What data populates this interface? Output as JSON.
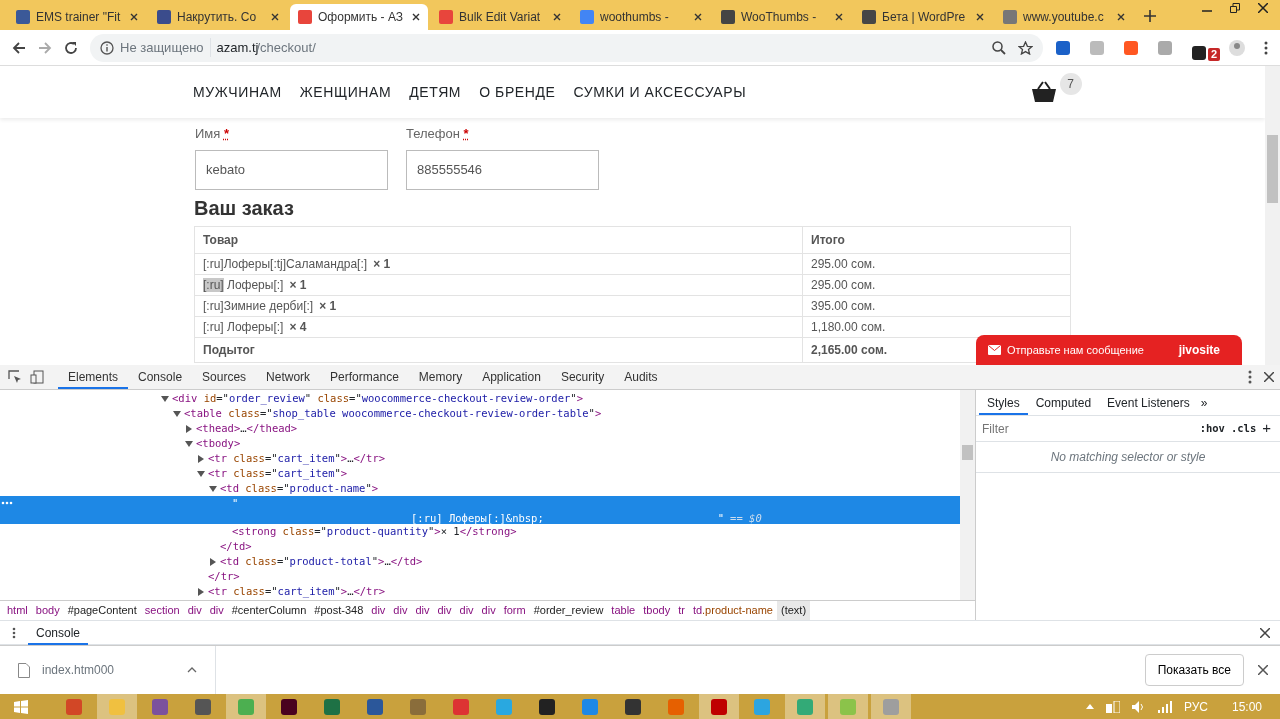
{
  "browser": {
    "tabs": [
      {
        "title": "EMS trainer \"Fit",
        "color": "#3b5998",
        "selected": false
      },
      {
        "title": "Накрутить. Co",
        "color": "#3b4c8c",
        "selected": false
      },
      {
        "title": "Оформить - АЗ",
        "color": "#e8453c",
        "selected": true
      },
      {
        "title": "Bulk Edit Variat",
        "color": "#e8453c",
        "selected": false
      },
      {
        "title": "woothumbs - ",
        "color": "#4285f4",
        "selected": false
      },
      {
        "title": "WooThumbs - ",
        "color": "#444444",
        "selected": false
      },
      {
        "title": "Бета | WordPre",
        "color": "#464646",
        "selected": false
      },
      {
        "title": "www.youtube.c",
        "color": "#777777",
        "selected": false
      }
    ],
    "security": "Не защищено",
    "url_host": "azam.tj",
    "url_path": "/checkout/",
    "extension_badge": "2"
  },
  "site": {
    "nav": [
      "МУЖЧИНАМ",
      "ЖЕНЩИНАМ",
      "ДЕТЯМ",
      "О БРЕНДЕ",
      "СУМКИ И АКСЕССУАРЫ"
    ],
    "cart_count": "7",
    "fields": [
      {
        "label": "Имя",
        "required_mark": "*",
        "value": "kebato"
      },
      {
        "label": "Телефон",
        "required_mark": "*",
        "value": "885555546"
      }
    ],
    "heading": "Ваш заказ",
    "table": {
      "columns": [
        "Товар",
        "Итого"
      ],
      "rows": [
        {
          "product": "[:ru]Лоферы[:tj]Саламандра[:]",
          "quantity": "× 1",
          "total": "295.00 сом."
        },
        {
          "highlighted_text": "[:ru]",
          "product": " Лоферы[:]",
          "quantity": "× 1",
          "total": "295.00 сом."
        },
        {
          "product": "[:ru]Зимние дерби[:]",
          "quantity": "× 1",
          "total": "395.00 сом."
        },
        {
          "product": "[:ru] Лоферы[:]",
          "quantity": "× 4",
          "total": "1,180.00 сом."
        }
      ],
      "subtotal_label": "Подытог",
      "subtotal": "2,165.00 сом."
    },
    "chat": {
      "text": "Отправьте нам сообщение",
      "brand": "jivosite"
    }
  },
  "devtools": {
    "tabs": [
      {
        "label": "Elements",
        "selected": true
      },
      {
        "label": "Console",
        "selected": false
      },
      {
        "label": "Sources",
        "selected": false
      },
      {
        "label": "Network",
        "selected": false
      },
      {
        "label": "Performance",
        "selected": false
      },
      {
        "label": "Memory",
        "selected": false
      },
      {
        "label": "Application",
        "selected": false
      },
      {
        "label": "Security",
        "selected": false
      },
      {
        "label": "Audits",
        "selected": false
      }
    ],
    "tree": [
      {
        "open": "<div id=\"order_review\" class=\"woocommerce-checkout-review-order\">",
        "expanded": true,
        "selected": false,
        "children": [
          {
            "open": "<table class=\"shop_table woocommerce-checkout-review-order-table\">",
            "expanded": true,
            "selected": false,
            "children": [
              {
                "open": "<thead>…</thead>",
                "expanded": false,
                "selected": false
              },
              {
                "open": "<tbody>",
                "expanded": true,
                "selected": false,
                "children": [
                  {
                    "open": "<tr class=\"cart_item\">…</tr>",
                    "expanded": false,
                    "selected": false
                  },
                  {
                    "open": "<tr class=\"cart_item\">",
                    "expanded": true,
                    "selected": false,
                    "children": [
                      {
                        "open": "<td class=\"product-name\">",
                        "expanded": true,
                        "selected": false,
                        "children": [
                          {
                            "text_lines": [
                              "\"",
                              "[:ru] Лоферы[:]&nbsp;"
                            ],
                            "suffix": "\"",
                            "ref": "== $0",
                            "selected": true
                          },
                          {
                            "open": "<strong class=\"product-quantity\">× 1</strong>",
                            "selected": false
                          }
                        ],
                        "close": "</td>"
                      },
                      {
                        "open": "<td class=\"product-total\">…</td>",
                        "expanded": false,
                        "selected": false
                      }
                    ],
                    "close": "</tr>"
                  },
                  {
                    "open": "<tr class=\"cart_item\">…</tr>",
                    "expanded": false,
                    "selected": false
                  }
                ]
              }
            ]
          }
        ]
      }
    ],
    "breadcrumb": [
      {
        "label": "html",
        "selected": false
      },
      {
        "label": "body",
        "selected": false
      },
      {
        "label": "#pageContent",
        "selected": false
      },
      {
        "label": "section",
        "selected": false
      },
      {
        "label": "div",
        "selected": false
      },
      {
        "label": "div",
        "selected": false
      },
      {
        "label": "#centerColumn",
        "selected": false
      },
      {
        "label": "#post-348",
        "selected": false
      },
      {
        "label": "div",
        "selected": false
      },
      {
        "label": "div",
        "selected": false
      },
      {
        "label": "div",
        "selected": false
      },
      {
        "label": "div",
        "selected": false
      },
      {
        "label": "div",
        "selected": false
      },
      {
        "label": "div",
        "selected": false
      },
      {
        "label": "form",
        "selected": false
      },
      {
        "label": "#order_review",
        "selected": false
      },
      {
        "label": "table",
        "selected": false
      },
      {
        "label": "tbody",
        "selected": false
      },
      {
        "label": "tr",
        "selected": false
      },
      {
        "label": "td.product-name",
        "selected": false
      },
      {
        "label": "(text)",
        "selected": true
      }
    ],
    "side_tabs": [
      {
        "label": "Styles",
        "selected": true
      },
      {
        "label": "Computed",
        "selected": false
      },
      {
        "label": "Event Listeners",
        "selected": false
      }
    ],
    "side_more": "»",
    "filter_placeholder": "Filter",
    "hov": ":hov",
    "cls": ".cls",
    "add": "+",
    "empty_message": "No matching selector or style",
    "drawer_tab": "Console"
  },
  "downloads": {
    "file": "index.htm000",
    "show_all": "Показать все"
  },
  "taskbar": {
    "apps": [
      {
        "color": "#d24726",
        "running": false
      },
      {
        "color": "#f0c040",
        "running": true
      },
      {
        "color": "#7b519d",
        "running": false
      },
      {
        "color": "#555555",
        "running": false
      },
      {
        "color": "#4caf50",
        "running": true
      },
      {
        "color": "#49021f",
        "running": false
      },
      {
        "color": "#1e7145",
        "running": false
      },
      {
        "color": "#2b579a",
        "running": false
      },
      {
        "color": "#8a6d3b",
        "running": false
      },
      {
        "color": "#dd3333",
        "running": false
      },
      {
        "color": "#29a8e0",
        "running": false
      },
      {
        "color": "#222222",
        "running": false
      },
      {
        "color": "#1e88e5",
        "running": false
      },
      {
        "color": "#333333",
        "running": false
      },
      {
        "color": "#e66000",
        "running": false
      },
      {
        "color": "#bf0000",
        "running": true
      },
      {
        "color": "#2ca5e0",
        "running": false
      },
      {
        "color": "#33aa77",
        "running": true
      },
      {
        "color": "#8bc34a",
        "running": true
      },
      {
        "color": "#9e9e9e",
        "running": true
      }
    ],
    "language": "РУС",
    "time": "15:00"
  }
}
